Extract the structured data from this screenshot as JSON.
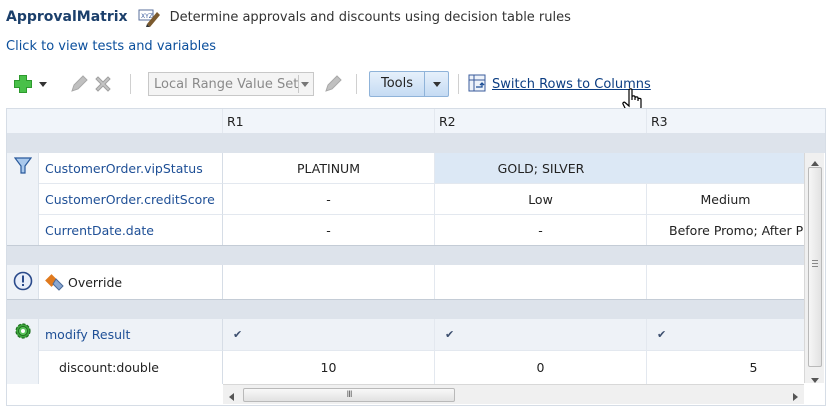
{
  "header": {
    "title": "ApprovalMatrix",
    "description": "Determine approvals and discounts using decision table rules"
  },
  "tests_link": "Click to view tests and variables",
  "toolbar": {
    "range_value_set": "Local Range Value Set",
    "tools_label": "Tools",
    "switch_label": "Switch Rows to Columns"
  },
  "columns": [
    "R1",
    "R2",
    "R3"
  ],
  "conditions": [
    {
      "label": "CustomerOrder.vipStatus",
      "values": [
        "PLATINUM",
        "GOLD; SILVER",
        ""
      ]
    },
    {
      "label": "CustomerOrder.creditScore",
      "values": [
        "-",
        "Low",
        "Medium"
      ]
    },
    {
      "label": "CurrentDate.date",
      "values": [
        "-",
        "-",
        "Before Promo; After Pr"
      ]
    }
  ],
  "override": {
    "label": "Override"
  },
  "actions": {
    "label": "modify Result",
    "checks": [
      "✔",
      "✔",
      "✔"
    ],
    "param": {
      "label": "discount:double",
      "values": [
        "10",
        "0",
        "5"
      ]
    }
  },
  "scroll_grip": "III",
  "colors": {
    "link": "#1e4f96",
    "highlight": "#dce8f5",
    "band": "#dde3eb",
    "tools_bg": "#c5dbf3"
  }
}
